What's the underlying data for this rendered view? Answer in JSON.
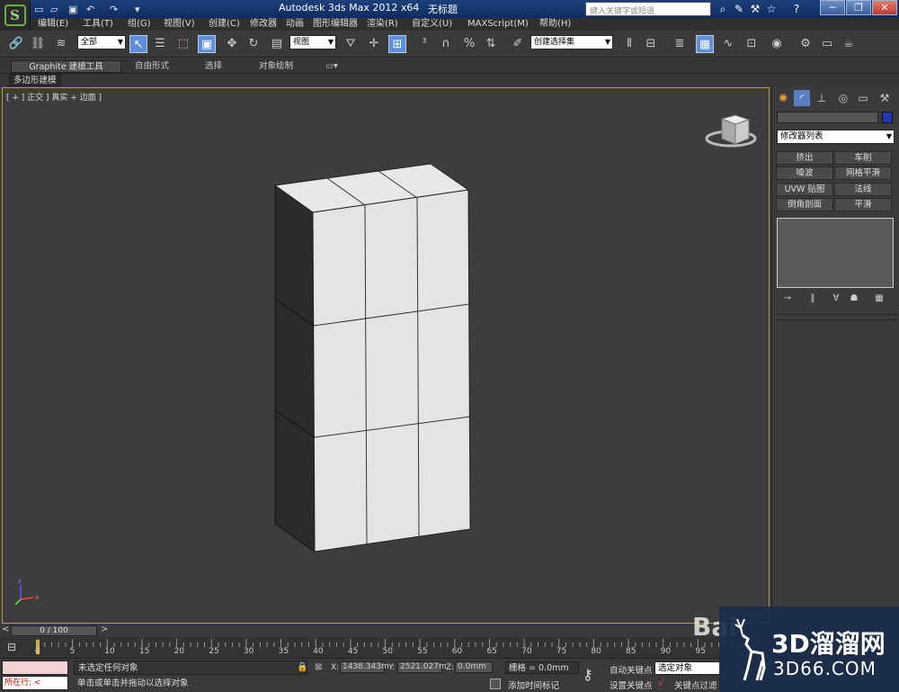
{
  "titlebar": {
    "app_title": "Autodesk 3ds Max  2012 x64",
    "doc_title": "无标题",
    "search_placeholder": "键入关键字或短语"
  },
  "menu": {
    "items": [
      "编辑(E)",
      "工具(T)",
      "组(G)",
      "视图(V)",
      "创建(C)",
      "修改器",
      "动画",
      "图形编辑器",
      "渲染(R)",
      "自定义(U)",
      "MAXScript(M)",
      "帮助(H)"
    ]
  },
  "toolbar": {
    "selection_filter": "全部",
    "reference_coord": "视图",
    "named_selection": "创建选择集"
  },
  "ribbon": {
    "tabs": [
      "Graphite 建模工具",
      "自由形式",
      "选择",
      "对象绘制"
    ],
    "sub": "多边形建模"
  },
  "viewport": {
    "label": "[ + ] 正交 ] 真实 + 边面 ]"
  },
  "command_panel": {
    "modifier_list": "修改器列表",
    "modifiers": [
      "挤出",
      "车削",
      "噪波",
      "网格平滑",
      "UVW 贴图",
      "法线",
      "倒角剖面",
      "平滑"
    ]
  },
  "timeline": {
    "slider": "0 / 100",
    "ticks": [
      "0",
      "5",
      "10",
      "15",
      "20",
      "25",
      "30",
      "35",
      "40",
      "45",
      "50",
      "55",
      "60",
      "65",
      "70",
      "75",
      "80",
      "85",
      "90",
      "95"
    ]
  },
  "status": {
    "maxscript": "所在行:",
    "selection": "未选定任何对象",
    "prompt": "单击或单击并拖动以选择对象",
    "x_label": "X:",
    "x_value": "1438.343m",
    "y_label": "Y:",
    "y_value": "2521.027m",
    "z_label": "Z:",
    "z_value": "0.0mm",
    "grid": "栅格 = 0.0mm",
    "add_time_tag": "添加时间标记",
    "auto_key": "自动关键点",
    "set_key": "设置关键点",
    "selected_object": "选定对象",
    "key_filters": "关键点过滤"
  },
  "watermark": {
    "baidu": "Bai",
    "main": "3D溜溜网",
    "url": "3D66.COM"
  }
}
